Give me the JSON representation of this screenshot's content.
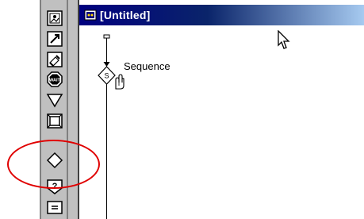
{
  "window": {
    "title": "[Untitled]",
    "title_icon": "flowline-window-icon"
  },
  "toolbar": {
    "icons": [
      "display-icon",
      "animation-icon",
      "erase-icon",
      "wait-icon",
      "navigate-icon",
      "framework-icon",
      "decision-icon",
      "interaction-icon",
      "calculation-icon"
    ],
    "wait_label": "WAIT"
  },
  "flowline": {
    "sequence_label": "Sequence",
    "decision_letter": "S"
  },
  "colors": {
    "titlebar_start": "#000080",
    "titlebar_end": "#a6caf0",
    "annotation": "#e00000",
    "toolbar_bg": "#c0c0c0"
  }
}
